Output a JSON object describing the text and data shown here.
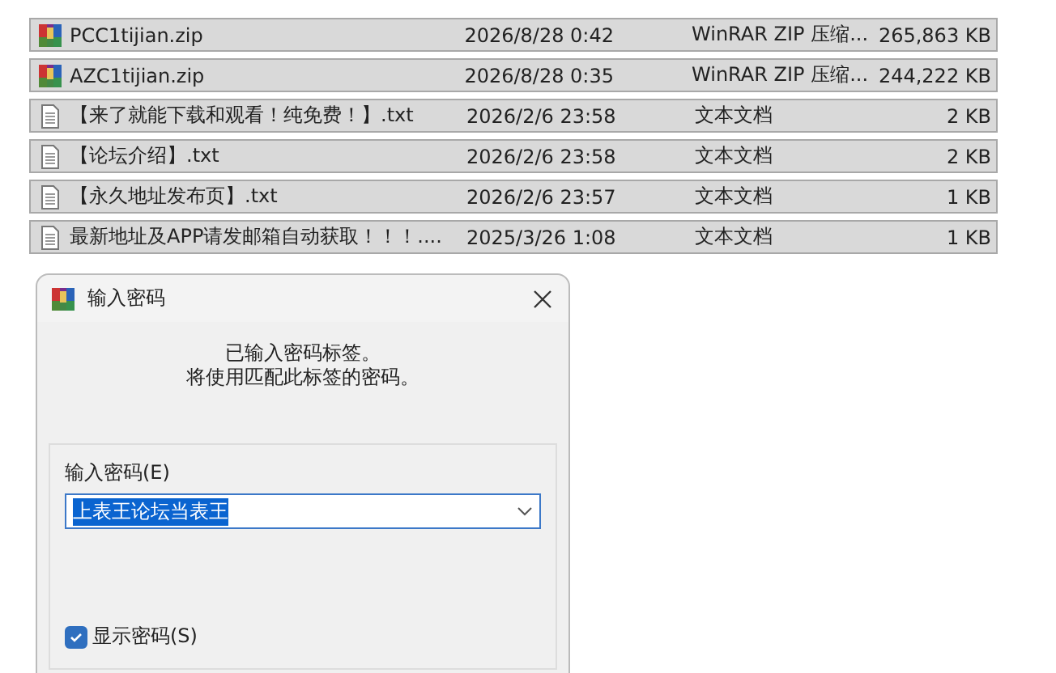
{
  "files": [
    {
      "name": "PCC1tijian.zip",
      "date": "2026/8/28 0:42",
      "type": "WinRAR ZIP 压缩...",
      "size": "265,863 KB",
      "kind": "archive",
      "selected": true
    },
    {
      "name": "AZC1tijian.zip",
      "date": "2026/8/28 0:35",
      "type": "WinRAR ZIP 压缩...",
      "size": "244,222 KB",
      "kind": "archive",
      "selected": true
    },
    {
      "name": "【来了就能下载和观看！纯免费！】.txt",
      "date": "2026/2/6 23:58",
      "type": "文本文档",
      "size": "2 KB",
      "kind": "text",
      "selected": true
    },
    {
      "name": "【论坛介绍】.txt",
      "date": "2026/2/6 23:58",
      "type": "文本文档",
      "size": "2 KB",
      "kind": "text",
      "selected": true
    },
    {
      "name": "【永久地址发布页】.txt",
      "date": "2026/2/6 23:57",
      "type": "文本文档",
      "size": "1 KB",
      "kind": "text",
      "selected": true
    },
    {
      "name": "最新地址及APP请发邮箱自动获取！！！....",
      "date": "2025/3/26 1:08",
      "type": "文本文档",
      "size": "1 KB",
      "kind": "text",
      "selected": true
    }
  ],
  "dialog": {
    "title": "输入密码",
    "message": [
      "已输入密码标签。",
      "将使用匹配此标签的密码。"
    ],
    "password_label": "输入密码(E)",
    "password_value": "上表王论坛当表王",
    "show_password": {
      "label": "显示密码(S)",
      "checked": true
    }
  }
}
